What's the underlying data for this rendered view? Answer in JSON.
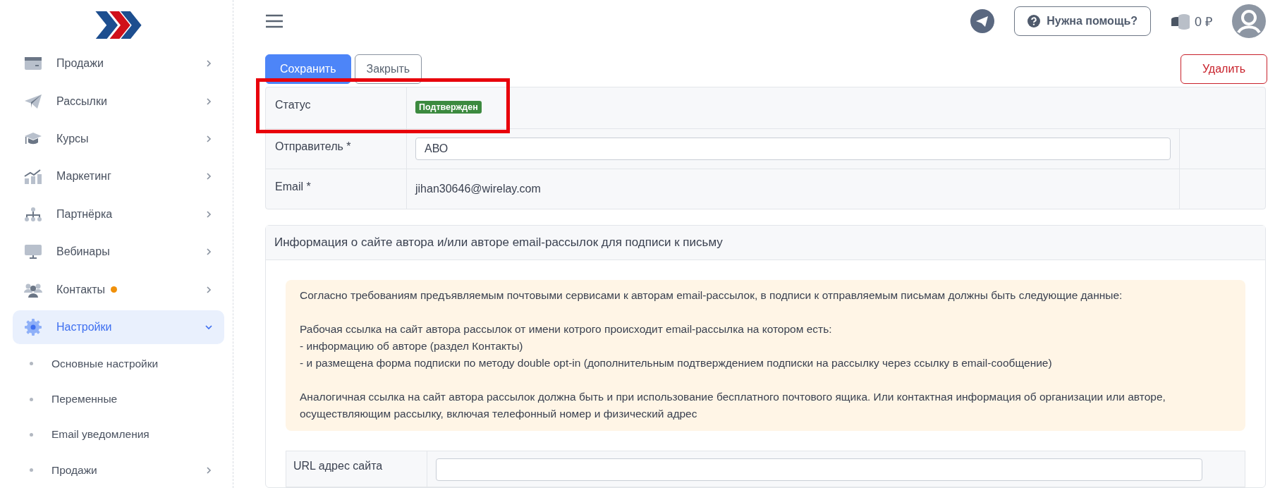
{
  "sidebar": {
    "items": [
      {
        "label": "Продажи",
        "selected": false,
        "expanded": false,
        "has_dot": false
      },
      {
        "label": "Рассылки",
        "selected": false,
        "expanded": false,
        "has_dot": false
      },
      {
        "label": "Курсы",
        "selected": false,
        "expanded": false,
        "has_dot": false
      },
      {
        "label": "Маркетинг",
        "selected": false,
        "expanded": false,
        "has_dot": false
      },
      {
        "label": "Партнёрка",
        "selected": false,
        "expanded": false,
        "has_dot": false
      },
      {
        "label": "Вебинары",
        "selected": false,
        "expanded": false,
        "has_dot": false
      },
      {
        "label": "Контакты",
        "selected": false,
        "expanded": false,
        "has_dot": true
      },
      {
        "label": "Настройки",
        "selected": true,
        "expanded": true,
        "has_dot": false,
        "children": [
          {
            "label": "Основные настройки",
            "has_arrow": false
          },
          {
            "label": "Переменные",
            "has_arrow": false
          },
          {
            "label": "Email уведомления",
            "has_arrow": false
          },
          {
            "label": "Продажи",
            "has_arrow": true
          }
        ]
      }
    ]
  },
  "header": {
    "help_button": "Нужна помощь?",
    "balance": "0 ₽"
  },
  "toolbar": {
    "save": "Сохранить",
    "close": "Закрыть",
    "delete": "Удалить"
  },
  "form_rows": [
    {
      "label": "Статус",
      "kind": "badge",
      "value": "Подтвержден",
      "highlighted": true
    },
    {
      "label": "Отправитель *",
      "kind": "input",
      "value": "АВО",
      "highlighted": false
    },
    {
      "label": "Email *",
      "kind": "text",
      "value": "jihan30646@wirelay.com",
      "highlighted": false
    }
  ],
  "section": {
    "title": "Информация о сайте автора и/или авторе email-рассылок для подписи к письму",
    "notice": [
      [
        "Согласно требованиям предъявляемым почтовыми сервисами к авторам email-рассылок, в подписи к отправляемым письмам должны быть следующие данные:"
      ],
      [
        "Рабочая ссылка на сайт автора рассылок от имени котрого происходит email-рассылка на котором есть:",
        "- информацию об авторе (раздел Контакты)",
        "- и размещена форма подписки по методу double opt-in (дополнительным подтверждением подписки на рассылку через ссылку в email-сообщение)"
      ],
      [
        "Аналогичная ссылка на сайт автора рассылок должна быть и при использование бесплатного почтового ящика. Или контактная информация об организации или авторе, осуществляющим рассылку, включая телефонный номер и физический адрес"
      ]
    ],
    "url_row": {
      "label": "URL адрес сайта"
    }
  }
}
